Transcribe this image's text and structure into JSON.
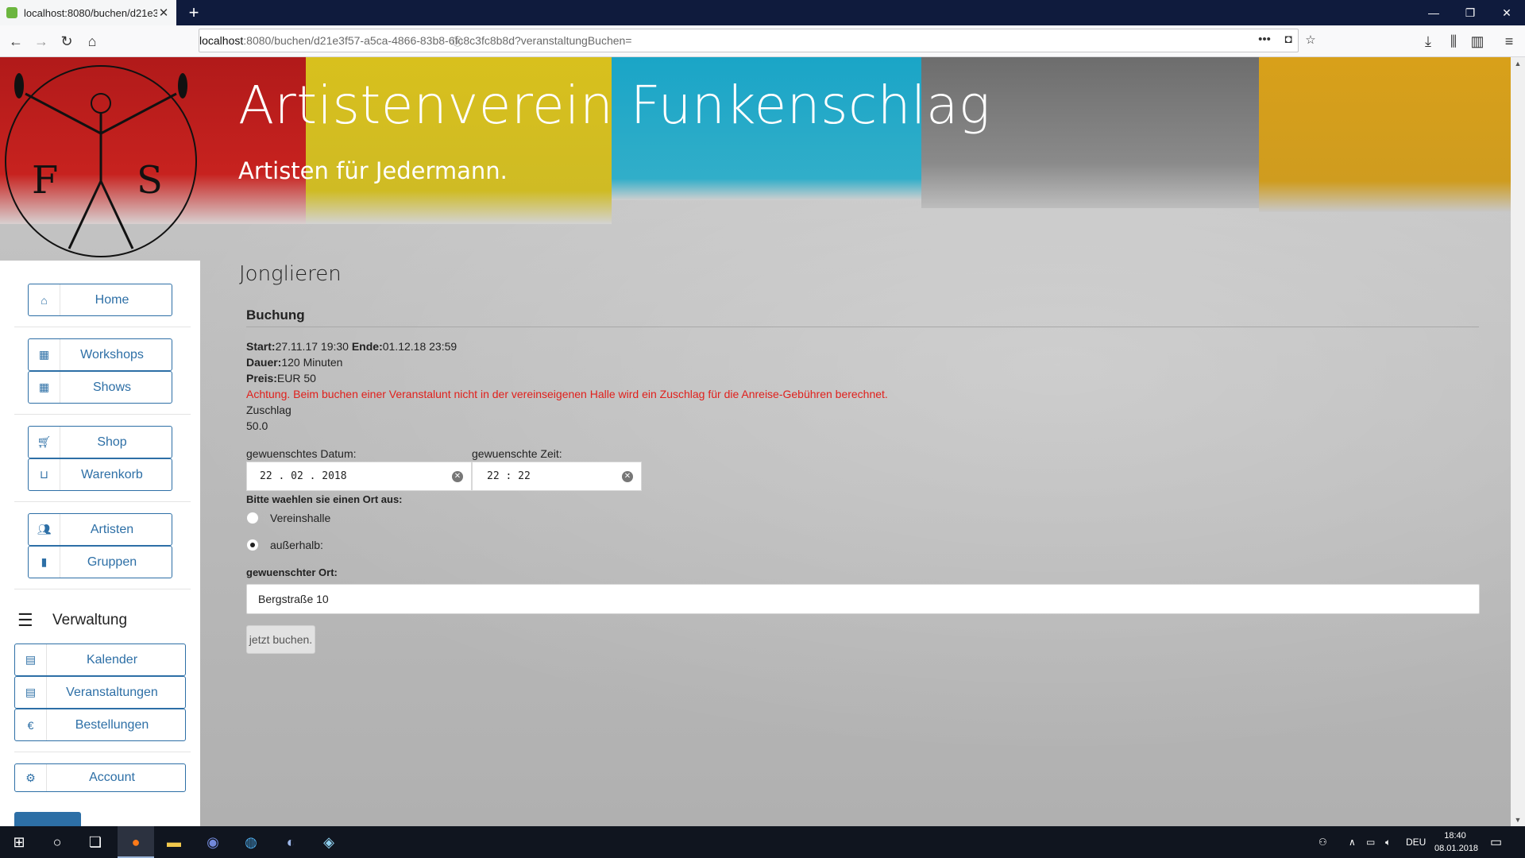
{
  "browser": {
    "tab_title": "localhost:8080/buchen/d21e3f5",
    "url_host": "localhost",
    "url_rest": ":8080/buchen/d21e3f57-a5ca-4866-83b8-6fc8c3fc8b8d?veranstaltungBuchen=",
    "icons": [
      "back-icon",
      "forward-icon",
      "reload-icon",
      "home-icon",
      "info-icon",
      "more-icon",
      "pocket-icon",
      "bookmark-star-icon",
      "download-icon",
      "library-icon",
      "sidebar-icon",
      "menu-icon"
    ]
  },
  "site": {
    "title": "Artistenverein Funkenschlag",
    "subtitle": "Artisten für Jedermann."
  },
  "sidebar": {
    "home": "Home",
    "workshops": "Workshops",
    "shows": "Shows",
    "shop": "Shop",
    "warenkorb": "Warenkorb",
    "artisten": "Artisten",
    "gruppen": "Gruppen",
    "verwaltung": "Verwaltung",
    "kalender": "Kalender",
    "veranstaltungen": "Veranstaltungen",
    "bestellungen": "Bestellungen",
    "bestellungen_icon": "€",
    "account": "Account"
  },
  "main": {
    "event_title": "Jonglieren",
    "section_title": "Buchung",
    "start_label": "Start:",
    "start_value": "27.11.17 19:30",
    "ende_label": "Ende:",
    "ende_value": "01.12.18 23:59",
    "dauer_label": "Dauer:",
    "dauer_value": "120 Minuten",
    "preis_label": "Preis:",
    "preis_value": "EUR 50",
    "warning": "Achtung. Beim buchen einer Veranstalunt nicht in der vereinseigenen Halle wird ein Zuschlag für die Anreise-Gebühren berechnet.",
    "zuschlag_label": "Zuschlag",
    "zuschlag_value": "50.0",
    "date_label": "gewuenschtes Datum:",
    "date_value": "22 . 02 . 2018",
    "time_label": "gewuenschte Zeit:",
    "time_value": "22 : 22",
    "ort_prompt": "Bitte waehlen sie einen Ort aus:",
    "option_halle": "Vereinshalle",
    "option_ausserhalb": "außerhalb:",
    "selected_option": "außerhalb:",
    "ort_label": "gewuenschter Ort:",
    "ort_value": "Bergstraße 10",
    "submit_label": "jetzt buchen."
  },
  "taskbar": {
    "language": "DEU",
    "time": "18:40",
    "date": "08.01.2018"
  },
  "colors": {
    "accent": "#2d6fa6",
    "warning": "#e0201c"
  }
}
